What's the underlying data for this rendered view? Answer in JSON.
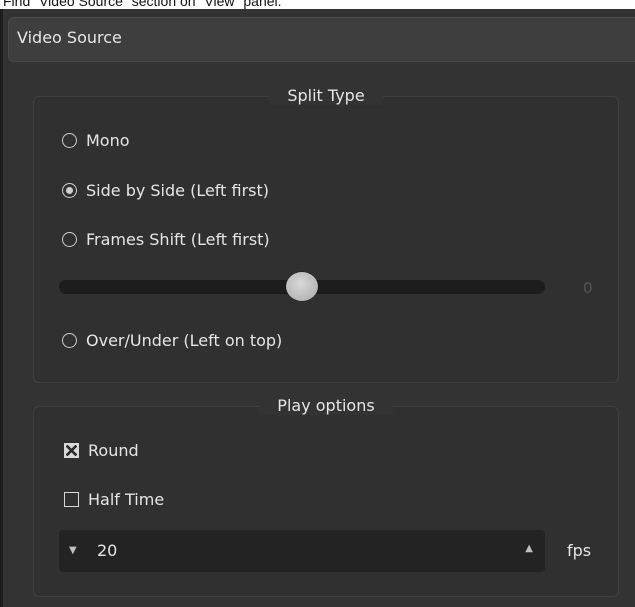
{
  "caption": "Find \"Video Source\" section on \"View\" panel.",
  "panel": {
    "title": "Video Source"
  },
  "split_type": {
    "title": "Split Type",
    "options": [
      {
        "label": "Mono",
        "selected": false
      },
      {
        "label": "Side by Side (Left first)",
        "selected": true
      },
      {
        "label": "Frames Shift (Left first)",
        "selected": false
      },
      {
        "label": "Over/Under (Left on top)",
        "selected": false
      }
    ],
    "shift_slider": {
      "value": "0",
      "position": 0.5
    }
  },
  "play_options": {
    "title": "Play options",
    "round": {
      "label": "Round",
      "checked": true
    },
    "half_time": {
      "label": "Half Time",
      "checked": false
    },
    "fps": {
      "value": "20",
      "unit": "fps"
    }
  },
  "icons": {
    "spin_down": "triangle-down-icon",
    "spin_up": "triangle-up-icon"
  },
  "colors": {
    "panel_bg": "#333333",
    "text": "#e6e6e6",
    "field_bg": "#232323"
  }
}
